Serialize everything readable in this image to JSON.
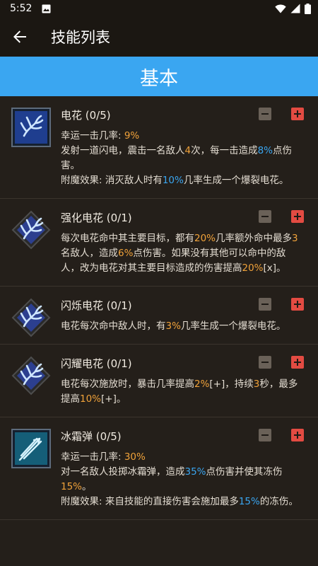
{
  "status": {
    "time": "5:52"
  },
  "header": {
    "title": "技能列表"
  },
  "category": {
    "label": "基本"
  },
  "skills": [
    {
      "name": "电花 (0/5)",
      "lines": [
        [
          [
            "幸运一击几率: ",
            ""
          ],
          [
            "9%",
            "or"
          ]
        ],
        [
          [
            "发射一道闪电，震击一名敌人",
            ""
          ],
          [
            "4",
            "or"
          ],
          [
            "次，每一击造成",
            ""
          ],
          [
            "8%",
            "bl"
          ],
          [
            "点伤",
            ""
          ]
        ],
        [
          [
            "害。",
            ""
          ]
        ],
        [
          [
            "附魔效果: 消灭敌人时有",
            ""
          ],
          [
            "10%",
            "bl"
          ],
          [
            "几率生成一个爆裂电花。",
            ""
          ]
        ]
      ],
      "icon": "lightning-fork-icon"
    },
    {
      "name": "强化电花 (0/1)",
      "lines": [
        [
          [
            "每次电花命中其主要目标，都有",
            ""
          ],
          [
            "20%",
            "or"
          ],
          [
            "几率额外命中最多",
            ""
          ],
          [
            "3",
            "or"
          ]
        ],
        [
          [
            "名敌人，造成",
            ""
          ],
          [
            "6%",
            "or"
          ],
          [
            "点伤害。如果没有其他可以命中的敌",
            ""
          ]
        ],
        [
          [
            "人，改为电花对其主要目标造成的伤害提高",
            ""
          ],
          [
            "20%",
            "or"
          ],
          [
            "[x]。",
            ""
          ]
        ]
      ],
      "icon": "lightning-diamond-icon"
    },
    {
      "name": "闪烁电花 (0/1)",
      "lines": [
        [
          [
            "电花每次命中敌人时，有",
            ""
          ],
          [
            "3%",
            "or"
          ],
          [
            "几率生成一个爆裂电花。",
            ""
          ]
        ]
      ],
      "icon": "lightning-diamond-icon"
    },
    {
      "name": "闪耀电花 (0/1)",
      "lines": [
        [
          [
            "电花每次施放时，暴击几率提高",
            ""
          ],
          [
            "2%",
            "or"
          ],
          [
            "[+]，持续",
            ""
          ],
          [
            "3",
            "or"
          ],
          [
            "秒，最多",
            ""
          ]
        ],
        [
          [
            "提高",
            ""
          ],
          [
            "10%",
            "or"
          ],
          [
            "[+]。",
            ""
          ]
        ]
      ],
      "icon": "lightning-diamond-icon"
    },
    {
      "name": "冰霜弹 (0/5)",
      "lines": [
        [
          [
            "幸运一击几率: ",
            ""
          ],
          [
            "30%",
            "or"
          ]
        ],
        [
          [
            "对一名敌人投掷冰霜弹，造成",
            ""
          ],
          [
            "35%",
            "bl"
          ],
          [
            "点伤害并使其冻伤",
            ""
          ]
        ],
        [
          [
            "15%",
            "or"
          ],
          [
            "。",
            ""
          ]
        ],
        [
          [
            "附魔效果: 来自技能的直接伤害会施加最多",
            ""
          ],
          [
            "15%",
            "bl"
          ],
          [
            "的冻伤。",
            ""
          ]
        ]
      ],
      "icon": "frost-bolt-icon"
    }
  ],
  "colors": {
    "accent": "#3aa6f1",
    "highlight": "#f0a23a",
    "plus": "#e34b42",
    "minus": "#6a6158"
  }
}
